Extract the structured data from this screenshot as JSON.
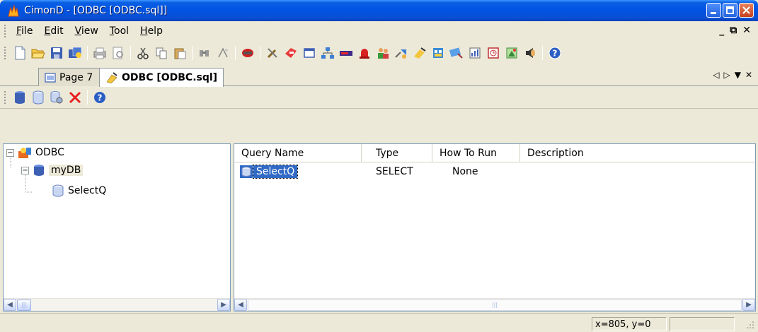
{
  "window": {
    "title": "CimonD - [ODBC [ODBC.sql]]"
  },
  "menu": {
    "items": [
      {
        "label": "File",
        "mnemonic": "F",
        "rest": "ile"
      },
      {
        "label": "Edit",
        "mnemonic": "E",
        "rest": "dit"
      },
      {
        "label": "View",
        "mnemonic": "V",
        "rest": "iew"
      },
      {
        "label": "Tool",
        "mnemonic": "T",
        "rest": "ool"
      },
      {
        "label": "Help",
        "mnemonic": "H",
        "rest": "elp"
      }
    ],
    "mdi_minimize": "_",
    "mdi_restore": "⧉",
    "mdi_close": "✕"
  },
  "toolbar": {
    "icons": [
      "new-icon",
      "open-icon",
      "save-icon",
      "save-all-icon",
      "print-icon",
      "print-preview-icon",
      "cut-icon",
      "copy-icon",
      "paste-icon",
      "find-icon",
      "replace-icon",
      "debug-icon",
      "tools-icon",
      "tag-icon",
      "window-icon",
      "network-icon",
      "bar-icon",
      "alarm-icon",
      "users-icon",
      "link-icon",
      "script-icon",
      "report-icon",
      "recipe-icon",
      "chart-icon",
      "timer-icon",
      "image-icon",
      "sound-icon",
      "help-icon"
    ]
  },
  "tabs": [
    {
      "label": "Page 7",
      "icon": "page-icon"
    },
    {
      "label": "ODBC [ODBC.sql]",
      "icon": "odbc-icon"
    }
  ],
  "tab_controls": {
    "prev": "◁",
    "next": "▷",
    "menu": "▼",
    "close": "✕"
  },
  "inner_toolbar": {
    "icons": [
      "add-database-icon",
      "add-query-icon",
      "properties-icon",
      "delete-icon",
      "help-icon"
    ]
  },
  "tree": {
    "root": {
      "label": "ODBC",
      "expander": "−"
    },
    "database": {
      "label": "myDB",
      "expander": "−"
    },
    "query": {
      "label": "SelectQ"
    }
  },
  "list": {
    "columns": [
      "Query Name",
      "Type",
      "How To Run",
      "Description"
    ],
    "rows": [
      {
        "name": "SelectQ",
        "type": "SELECT",
        "run": "None",
        "description": ""
      }
    ]
  },
  "status": {
    "coords": "x=805, y=0"
  },
  "colors": {
    "titlebar": "#0054e3",
    "selection": "#316ac5",
    "chrome": "#ece9d8"
  }
}
